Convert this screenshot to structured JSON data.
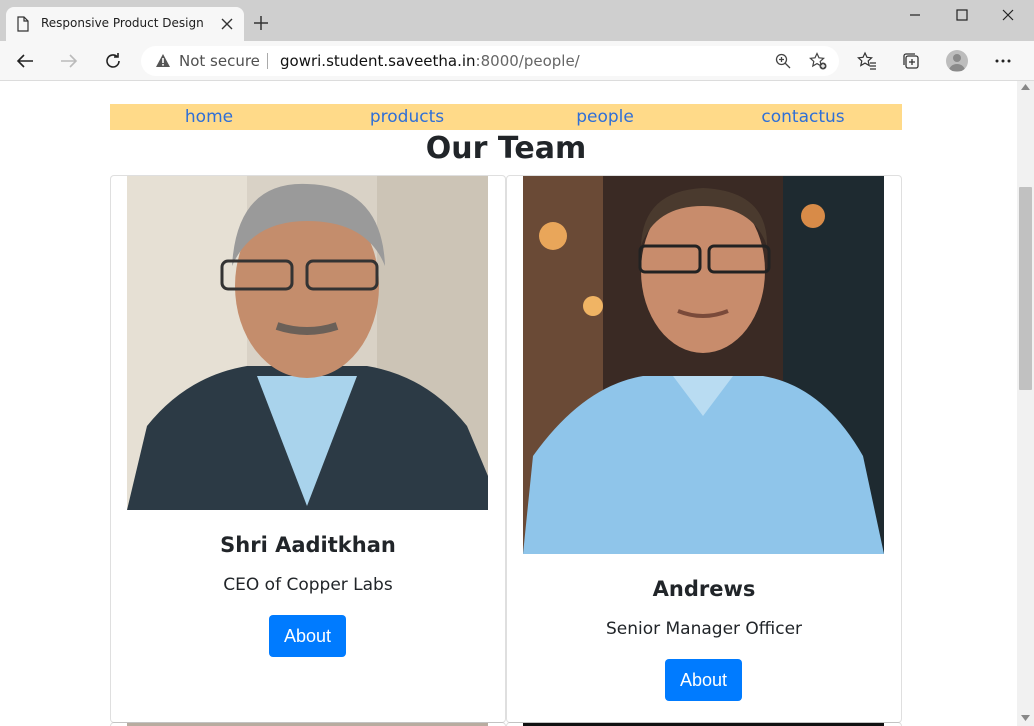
{
  "browser": {
    "tab_title": "Responsive Product Design",
    "security_label": "Not secure",
    "url_host": "gowri.student.saveetha.in",
    "url_rest": ":8000/people/"
  },
  "nav": {
    "items": [
      {
        "label": "home"
      },
      {
        "label": "products"
      },
      {
        "label": "people"
      },
      {
        "label": "contactus"
      }
    ]
  },
  "page": {
    "title": "Our Team"
  },
  "team": [
    {
      "name": "Shri Aaditkhan",
      "role": "CEO of Copper Labs",
      "button": "About"
    },
    {
      "name": "Andrews",
      "role": "Senior Manager Officer",
      "button": "About"
    }
  ],
  "colors": {
    "nav_bg": "#ffda89",
    "nav_link": "#2f6fd7",
    "button_bg": "#007bff"
  },
  "icons": [
    "page-icon",
    "close-icon",
    "plus-icon",
    "minimize-icon",
    "maximize-icon",
    "back-icon",
    "forward-icon",
    "reload-icon",
    "warning-icon",
    "zoom-icon",
    "add-favorite-icon",
    "favorites-icon",
    "collections-icon",
    "profile-icon",
    "more-icon"
  ]
}
